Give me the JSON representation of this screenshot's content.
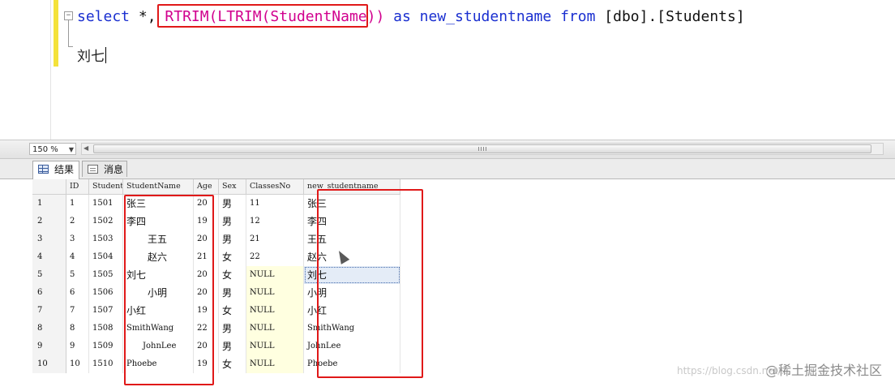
{
  "editor": {
    "code_select": "select",
    "code_star": " *,",
    "code_fn": "RTRIM(LTRIM(StudentName))",
    "code_as": " as new_studentname ",
    "code_from": "from",
    "code_table": " [dbo].[Students]",
    "line2_text": "刘七",
    "fold_symbol": "−"
  },
  "zoom": {
    "value": "150 %",
    "arrow_icon": "chevron-down-icon"
  },
  "tabs": [
    {
      "label": "结果",
      "icon": "grid-icon"
    },
    {
      "label": "消息",
      "icon": "message-icon"
    }
  ],
  "columns": [
    "ID",
    "StudentNo",
    "StudentName",
    "Age",
    "Sex",
    "ClassesNo",
    "new_studentname"
  ],
  "rows": [
    {
      "rn": "1",
      "id": "1",
      "no": "1501",
      "name": "张三",
      "age": "20",
      "sex": "男",
      "cls": "11",
      "new": "张三"
    },
    {
      "rn": "2",
      "id": "2",
      "no": "1502",
      "name": "李四",
      "age": "19",
      "sex": "男",
      "cls": "12",
      "new": "李四"
    },
    {
      "rn": "3",
      "id": "3",
      "no": "1503",
      "name": "王五",
      "age": "20",
      "sex": "男",
      "cls": "21",
      "new": "王五"
    },
    {
      "rn": "4",
      "id": "4",
      "no": "1504",
      "name": "赵六",
      "age": "21",
      "sex": "女",
      "cls": "22",
      "new": "赵六"
    },
    {
      "rn": "5",
      "id": "5",
      "no": "1505",
      "name": "刘七",
      "age": "20",
      "sex": "女",
      "cls": "NULL",
      "new": "刘七"
    },
    {
      "rn": "6",
      "id": "6",
      "no": "1506",
      "name": "小明",
      "age": "20",
      "sex": "男",
      "cls": "NULL",
      "new": "小明"
    },
    {
      "rn": "7",
      "id": "7",
      "no": "1507",
      "name": "小红",
      "age": "19",
      "sex": "女",
      "cls": "NULL",
      "new": "小红"
    },
    {
      "rn": "8",
      "id": "8",
      "no": "1508",
      "name": "SmithWang",
      "age": "22",
      "sex": "男",
      "cls": "NULL",
      "new": "SmithWang"
    },
    {
      "rn": "9",
      "id": "9",
      "no": "1509",
      "name": "JohnLee",
      "age": "20",
      "sex": "男",
      "cls": "NULL",
      "new": "JohnLee"
    },
    {
      "rn": "10",
      "id": "10",
      "no": "1510",
      "name": "Phoebe",
      "age": "19",
      "sex": "女",
      "cls": "NULL",
      "new": "Phoebe"
    }
  ],
  "name_indents": [
    0,
    0,
    26,
    26,
    0,
    26,
    0,
    0,
    20,
    0
  ],
  "selected_row": 5,
  "watermark": "@稀土掘金技术社区",
  "watermark_faint": "https://blog.csdn.net/..."
}
